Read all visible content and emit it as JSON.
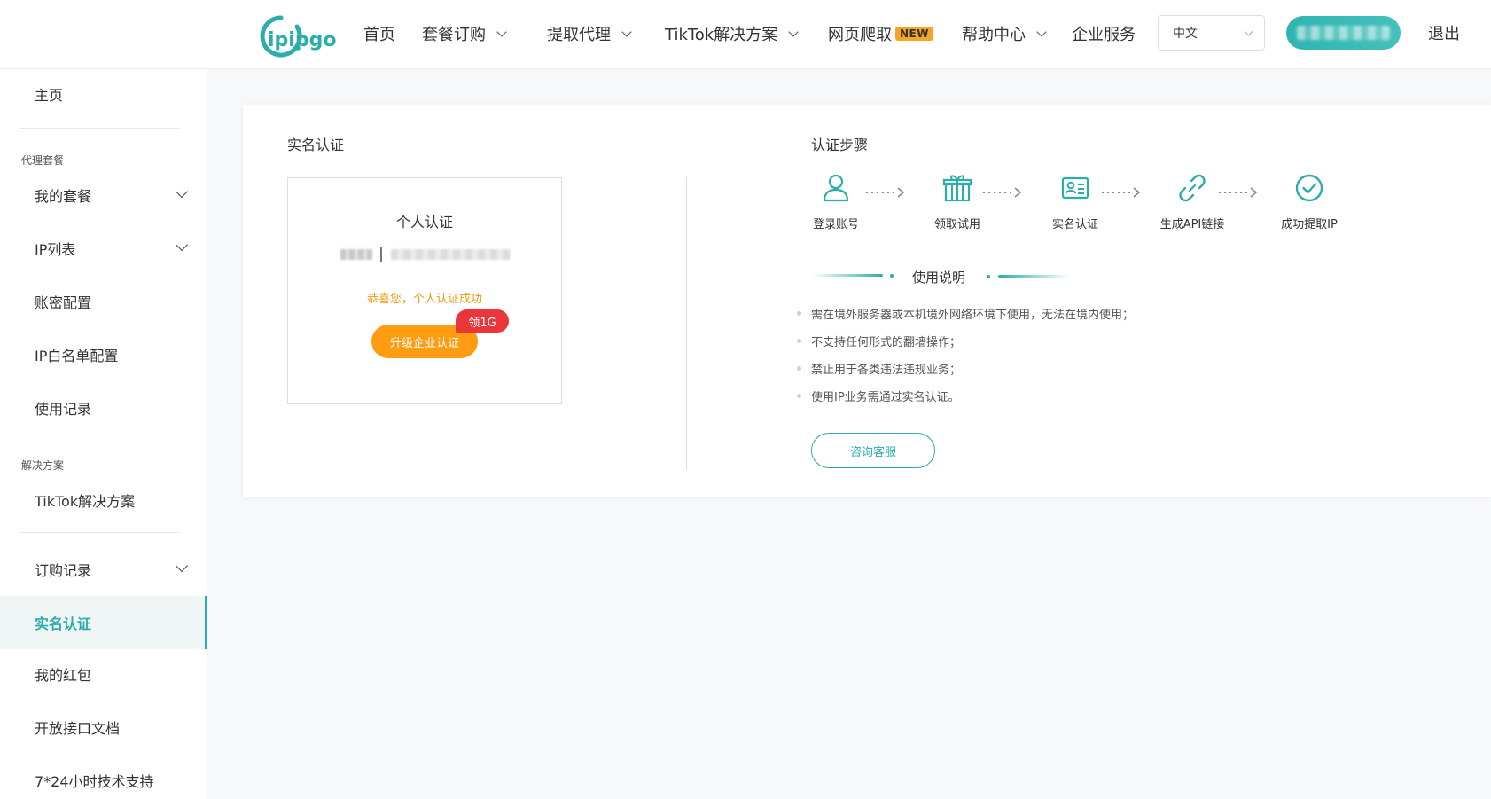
{
  "header": {
    "logo_text": "ipipgo",
    "nav": {
      "home": "首页",
      "packages": "套餐订购",
      "extract": "提取代理",
      "tiktok": "TikTok解决方案",
      "crawl": "网页爬取",
      "crawl_badge": "NEW",
      "help": "帮助中心",
      "enterprise": "企业服务"
    },
    "language": "中文",
    "logout": "退出",
    "brand_color": "#2bada9"
  },
  "sidebar": {
    "home": "主页",
    "section_proxy": "代理套餐",
    "my_packages": "我的套餐",
    "ip_list": "IP列表",
    "account_config": "账密配置",
    "whitelist": "IP白名单配置",
    "usage_records": "使用记录",
    "section_solutions": "解决方案",
    "tiktok": "TikTok解决方案",
    "order_records": "订购记录",
    "real_name": "实名认证",
    "red_packets": "我的红包",
    "api_docs": "开放接口文档",
    "support": "7*24小时技术支持"
  },
  "main": {
    "left_title": "实名认证",
    "personal": {
      "title": "个人认证",
      "success": "恭喜您，个人认证成功",
      "upgrade_button": "升级企业认证",
      "gift_badge": "领1G"
    },
    "steps_title": "认证步骤",
    "steps": [
      {
        "label": "登录账号",
        "icon": "user-icon"
      },
      {
        "label": "领取试用",
        "icon": "gift-icon"
      },
      {
        "label": "实名认证",
        "icon": "id-card-icon"
      },
      {
        "label": "生成API链接",
        "icon": "link-icon"
      },
      {
        "label": "成功提取IP",
        "icon": "check-circle-icon"
      }
    ],
    "usage_title": "使用说明",
    "notes": [
      "需在境外服务器或本机境外网络环境下使用，无法在境内使用；",
      "不支持任何形式的翻墙操作；",
      "禁止用于各类违法违规业务；",
      "使用IP业务需通过实名认证。"
    ],
    "consult_button": "咨询客服"
  }
}
